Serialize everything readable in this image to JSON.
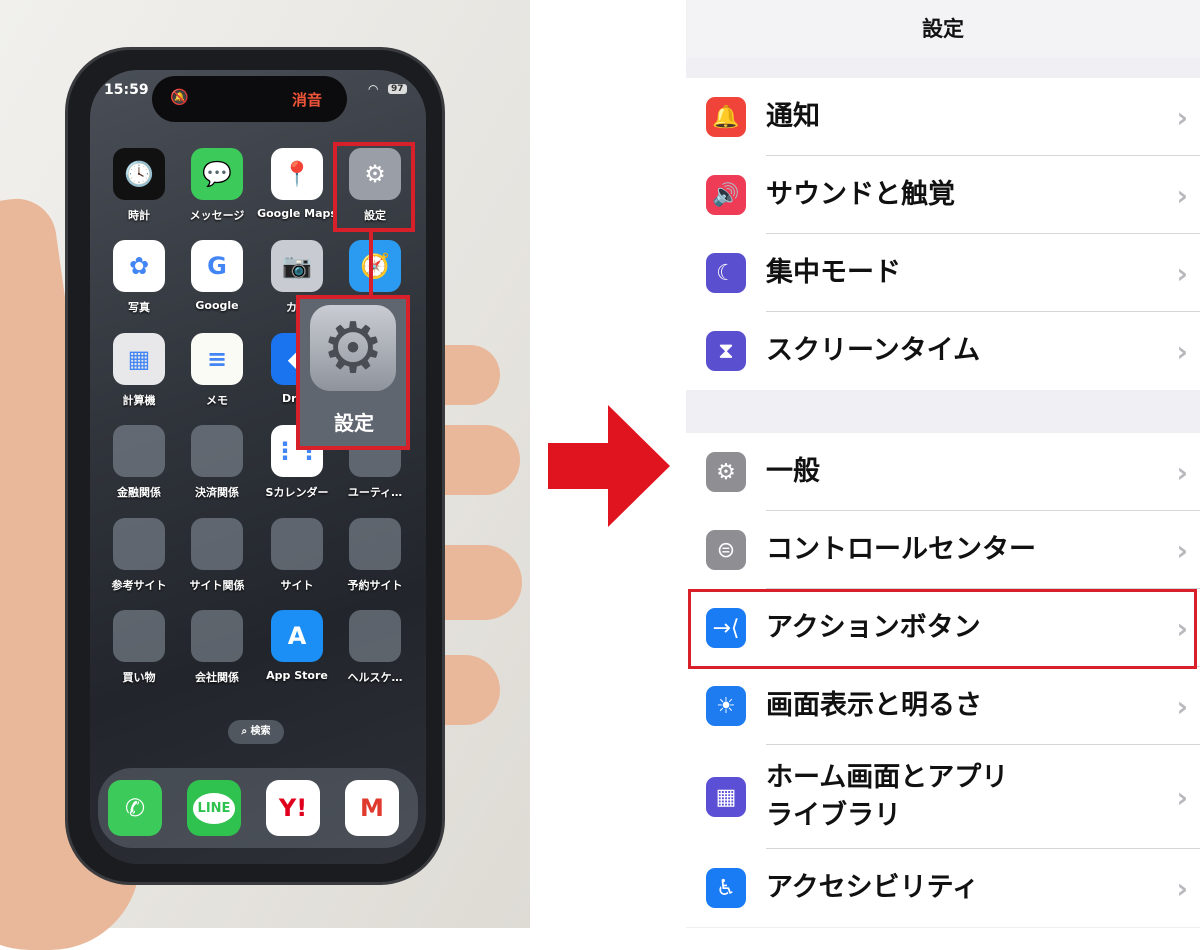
{
  "phone": {
    "status": {
      "time": "15:59",
      "mute_label": "消音",
      "battery": "97"
    },
    "apps": [
      {
        "label": "時計",
        "icon": "clock-icon",
        "bg": "#111",
        "glyph": "🕓"
      },
      {
        "label": "メッセージ",
        "icon": "messages-icon",
        "bg": "#3ccb5a",
        "glyph": "💬"
      },
      {
        "label": "Google Maps",
        "icon": "google-maps-icon",
        "bg": "#fff",
        "glyph": "📍"
      },
      {
        "label": "設定",
        "icon": "settings-gear-icon",
        "bg": "#9a9ea6",
        "glyph": "⚙"
      },
      {
        "label": "写真",
        "icon": "photos-icon",
        "bg": "#fff",
        "glyph": "✿"
      },
      {
        "label": "Google",
        "icon": "google-icon",
        "bg": "#fff",
        "glyph": "G"
      },
      {
        "label": "カメ",
        "icon": "camera-icon",
        "bg": "#c8ccd2",
        "glyph": "📷"
      },
      {
        "label": "",
        "icon": "safari-icon",
        "bg": "#2a9bf0",
        "glyph": "🧭"
      },
      {
        "label": "計算機",
        "icon": "calculator-icon",
        "bg": "#e8e8ea",
        "glyph": "▦"
      },
      {
        "label": "メモ",
        "icon": "notes-icon",
        "bg": "#fbfbf6",
        "glyph": "≡"
      },
      {
        "label": "Drop",
        "icon": "dropbox-icon",
        "bg": "#1a74f0",
        "glyph": "◆"
      },
      {
        "label": "",
        "icon": "folder-icon",
        "bg": "folder",
        "glyph": ""
      },
      {
        "label": "金融関係",
        "icon": "folder-icon",
        "bg": "folder",
        "glyph": ""
      },
      {
        "label": "決済関係",
        "icon": "folder-icon",
        "bg": "folder",
        "glyph": ""
      },
      {
        "label": "Sカレンダー",
        "icon": "calendar-icon",
        "bg": "#fff",
        "glyph": "⋮⋮"
      },
      {
        "label": "ユーティ…",
        "icon": "folder-icon",
        "bg": "folder",
        "glyph": ""
      },
      {
        "label": "参考サイト",
        "icon": "folder-icon",
        "bg": "folder",
        "glyph": ""
      },
      {
        "label": "サイト関係",
        "icon": "folder-icon",
        "bg": "folder",
        "glyph": ""
      },
      {
        "label": "サイト",
        "icon": "folder-icon",
        "bg": "folder",
        "glyph": ""
      },
      {
        "label": "予約サイト",
        "icon": "folder-icon",
        "bg": "folder",
        "glyph": ""
      },
      {
        "label": "買い物",
        "icon": "folder-icon",
        "bg": "folder",
        "glyph": ""
      },
      {
        "label": "会社関係",
        "icon": "folder-icon",
        "bg": "folder",
        "glyph": ""
      },
      {
        "label": "App Store",
        "icon": "app-store-icon",
        "bg": "#1b8ff5",
        "glyph": "A"
      },
      {
        "label": "ヘルスケ…",
        "icon": "folder-icon",
        "bg": "folder",
        "glyph": ""
      }
    ],
    "search_label": "検索",
    "dock": [
      {
        "icon": "phone-icon",
        "bg": "#3ccb5a",
        "glyph": "✆",
        "color": "#fff"
      },
      {
        "icon": "line-icon",
        "bg": "#2fc24f",
        "glyph": "LINE",
        "color": "#2fc24f"
      },
      {
        "icon": "yahoo-icon",
        "bg": "#fff",
        "glyph": "Y!",
        "color": "#e0001e"
      },
      {
        "icon": "gmail-icon",
        "bg": "#fff",
        "glyph": "M",
        "color": "#e03a2e"
      }
    ],
    "popup_label": "設定"
  },
  "highlight_color": "#d8202a",
  "settings": {
    "title": "設定",
    "groups": [
      [
        {
          "label": "通知",
          "icon": "bell-icon",
          "color": "#f0443a",
          "glyph": "🔔"
        },
        {
          "label": "サウンドと触覚",
          "icon": "speaker-icon",
          "color": "#ee3b56",
          "glyph": "🔊"
        },
        {
          "label": "集中モード",
          "icon": "moon-icon",
          "color": "#5a4fcf",
          "glyph": "☾"
        },
        {
          "label": "スクリーンタイム",
          "icon": "hourglass-icon",
          "color": "#5a4fcf",
          "glyph": "⧗"
        }
      ],
      [
        {
          "label": "一般",
          "icon": "gear-icon",
          "color": "#8e8e93",
          "glyph": "⚙"
        },
        {
          "label": "コントロールセンター",
          "icon": "toggles-icon",
          "color": "#8e8e93",
          "glyph": "⊜"
        },
        {
          "label": "アクションボタン",
          "icon": "action-button-icon",
          "color": "#1a7cf5",
          "glyph": "→⟨",
          "highlighted": true
        },
        {
          "label": "画面表示と明るさ",
          "icon": "sun-icon",
          "color": "#1f7cf0",
          "glyph": "☀"
        },
        {
          "label": "ホーム画面とアプリ\nライブラリ",
          "icon": "home-grid-icon",
          "color": "#5b4fd6",
          "glyph": "▦",
          "tall": true
        },
        {
          "label": "アクセシビリティ",
          "icon": "accessibility-icon",
          "color": "#1a7cf5",
          "glyph": "♿"
        }
      ]
    ]
  }
}
